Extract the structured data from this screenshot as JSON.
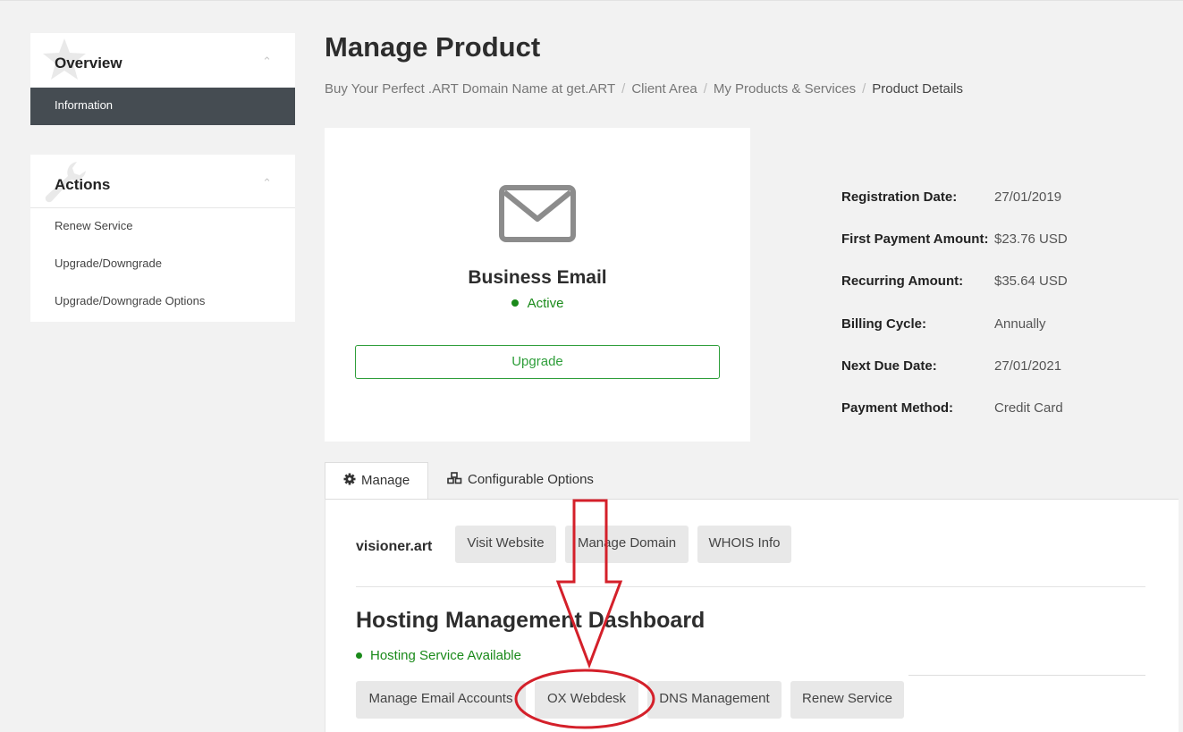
{
  "sidebar": {
    "overview": {
      "title": "Overview",
      "active_item": "Information"
    },
    "actions": {
      "title": "Actions",
      "items": [
        "Renew Service",
        "Upgrade/Downgrade",
        "Upgrade/Downgrade Options"
      ]
    }
  },
  "header": {
    "title": "Manage Product",
    "breadcrumb": [
      "Buy Your Perfect .ART Domain Name at get.ART",
      "Client Area",
      "My Products & Services",
      "Product Details"
    ]
  },
  "product": {
    "name": "Business Email",
    "status": "Active",
    "upgrade_label": "Upgrade",
    "icon": "envelope-icon"
  },
  "details": [
    {
      "label": "Registration Date:",
      "value": "27/01/2019"
    },
    {
      "label": "First Payment Amount:",
      "value": "$23.76 USD"
    },
    {
      "label": "Recurring Amount:",
      "value": "$35.64 USD"
    },
    {
      "label": "Billing Cycle:",
      "value": "Annually"
    },
    {
      "label": "Next Due Date:",
      "value": "27/01/2021"
    },
    {
      "label": "Payment Method:",
      "value": "Credit Card"
    }
  ],
  "tabs": [
    {
      "label": "Manage",
      "icon": "gear-icon",
      "active": true
    },
    {
      "label": "Configurable Options",
      "icon": "cubes-icon",
      "active": false
    }
  ],
  "manage": {
    "domain": "visioner.art",
    "domain_buttons": [
      "Visit Website",
      "Manage Domain",
      "WHOIS Info"
    ],
    "dashboard_title": "Hosting Management Dashboard",
    "hosting_status": "Hosting Service Available",
    "dashboard_buttons": [
      "Manage Email Accounts",
      "OX Webdesk",
      "DNS Management",
      "Renew Service"
    ]
  },
  "colors": {
    "active_green": "#1a8a1a",
    "upgrade_green": "#2e9e3a",
    "sidebar_active_bg": "#454c52",
    "annotation_red": "#d4202a"
  }
}
